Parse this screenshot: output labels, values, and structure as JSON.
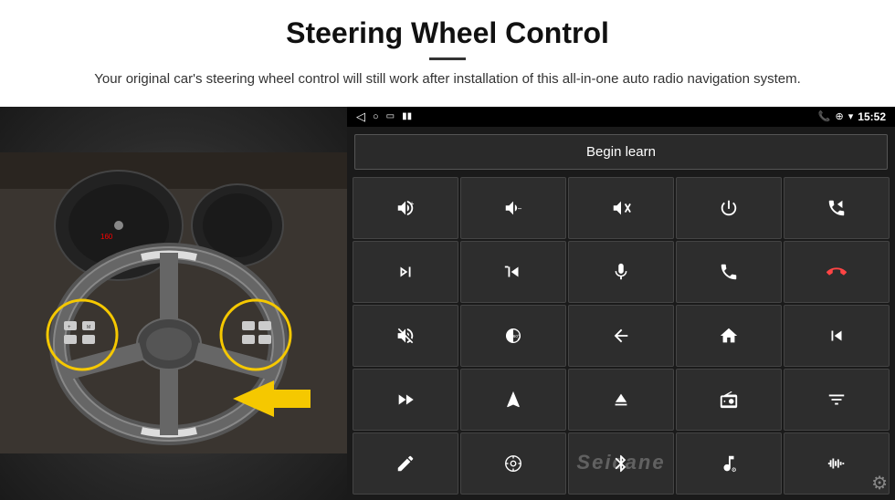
{
  "header": {
    "title": "Steering Wheel Control",
    "subtitle": "Your original car's steering wheel control will still work after installation of this all-in-one auto radio navigation system."
  },
  "status_bar": {
    "time": "15:52",
    "icons": [
      "phone",
      "location",
      "wifi",
      "signal"
    ]
  },
  "begin_learn_label": "Begin learn",
  "watermark": "Seicane",
  "controls": [
    {
      "id": "vol-up",
      "icon": "vol_up"
    },
    {
      "id": "vol-down",
      "icon": "vol_down"
    },
    {
      "id": "mute",
      "icon": "mute"
    },
    {
      "id": "power",
      "icon": "power"
    },
    {
      "id": "phone-prev",
      "icon": "phone_prev"
    },
    {
      "id": "next-track",
      "icon": "next"
    },
    {
      "id": "prev-skip",
      "icon": "prev_skip"
    },
    {
      "id": "mic",
      "icon": "mic"
    },
    {
      "id": "phone",
      "icon": "phone"
    },
    {
      "id": "hang-up",
      "icon": "hangup"
    },
    {
      "id": "horn",
      "icon": "horn"
    },
    {
      "id": "360",
      "icon": "360"
    },
    {
      "id": "back",
      "icon": "back"
    },
    {
      "id": "home",
      "icon": "home"
    },
    {
      "id": "prev-track",
      "icon": "prev_track"
    },
    {
      "id": "fast-fwd",
      "icon": "fast_fwd"
    },
    {
      "id": "nav",
      "icon": "nav"
    },
    {
      "id": "eject",
      "icon": "eject"
    },
    {
      "id": "radio",
      "icon": "radio"
    },
    {
      "id": "equalizer",
      "icon": "eq"
    },
    {
      "id": "pen",
      "icon": "pen"
    },
    {
      "id": "settings2",
      "icon": "settings2"
    },
    {
      "id": "bluetooth",
      "icon": "bluetooth"
    },
    {
      "id": "music",
      "icon": "music"
    },
    {
      "id": "waveform",
      "icon": "waveform"
    }
  ]
}
